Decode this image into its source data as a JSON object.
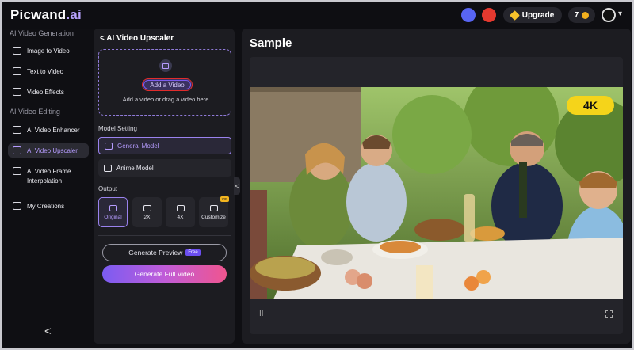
{
  "header": {
    "logo_main": "Picwand",
    "logo_suffix": ".ai",
    "upgrade_label": "Upgrade",
    "credits": "7"
  },
  "sidebar": {
    "section_generation": "AI Video Generation",
    "section_editing": "AI Video Editing",
    "items": [
      {
        "label": "Image to Video"
      },
      {
        "label": "Text to Video"
      },
      {
        "label": "Video Effects"
      },
      {
        "label": "AI Video Enhancer"
      },
      {
        "label": "AI Video Upscaler"
      },
      {
        "label": "AI Video Frame Interpolation"
      },
      {
        "label": "My Creations"
      }
    ],
    "collapse_glyph": "<"
  },
  "panel": {
    "title": "< AI Video Upscaler",
    "add_button": "Add a Video",
    "drop_hint": "Add a video or drag a video here",
    "model_setting_label": "Model Setting",
    "models": [
      {
        "label": "General Model",
        "selected": true
      },
      {
        "label": "Anime Model",
        "selected": false
      }
    ],
    "output_label": "Output",
    "outputs": [
      {
        "label": "Original",
        "selected": true
      },
      {
        "label": "2X"
      },
      {
        "label": "4X"
      },
      {
        "label": "Customize"
      }
    ],
    "customize_tag": "VIP",
    "generate_preview": "Generate Preview",
    "free_badge": "Free",
    "generate_full": "Generate Full Video",
    "handle_glyph": "<"
  },
  "preview": {
    "title": "Sample",
    "resolution_badge": "4K",
    "pause_glyph": "II"
  },
  "colors": {
    "accent": "#b69cff",
    "badge_4k": "#f5d41a",
    "gradient_start": "#7b5cf2",
    "gradient_end": "#f0558f"
  }
}
